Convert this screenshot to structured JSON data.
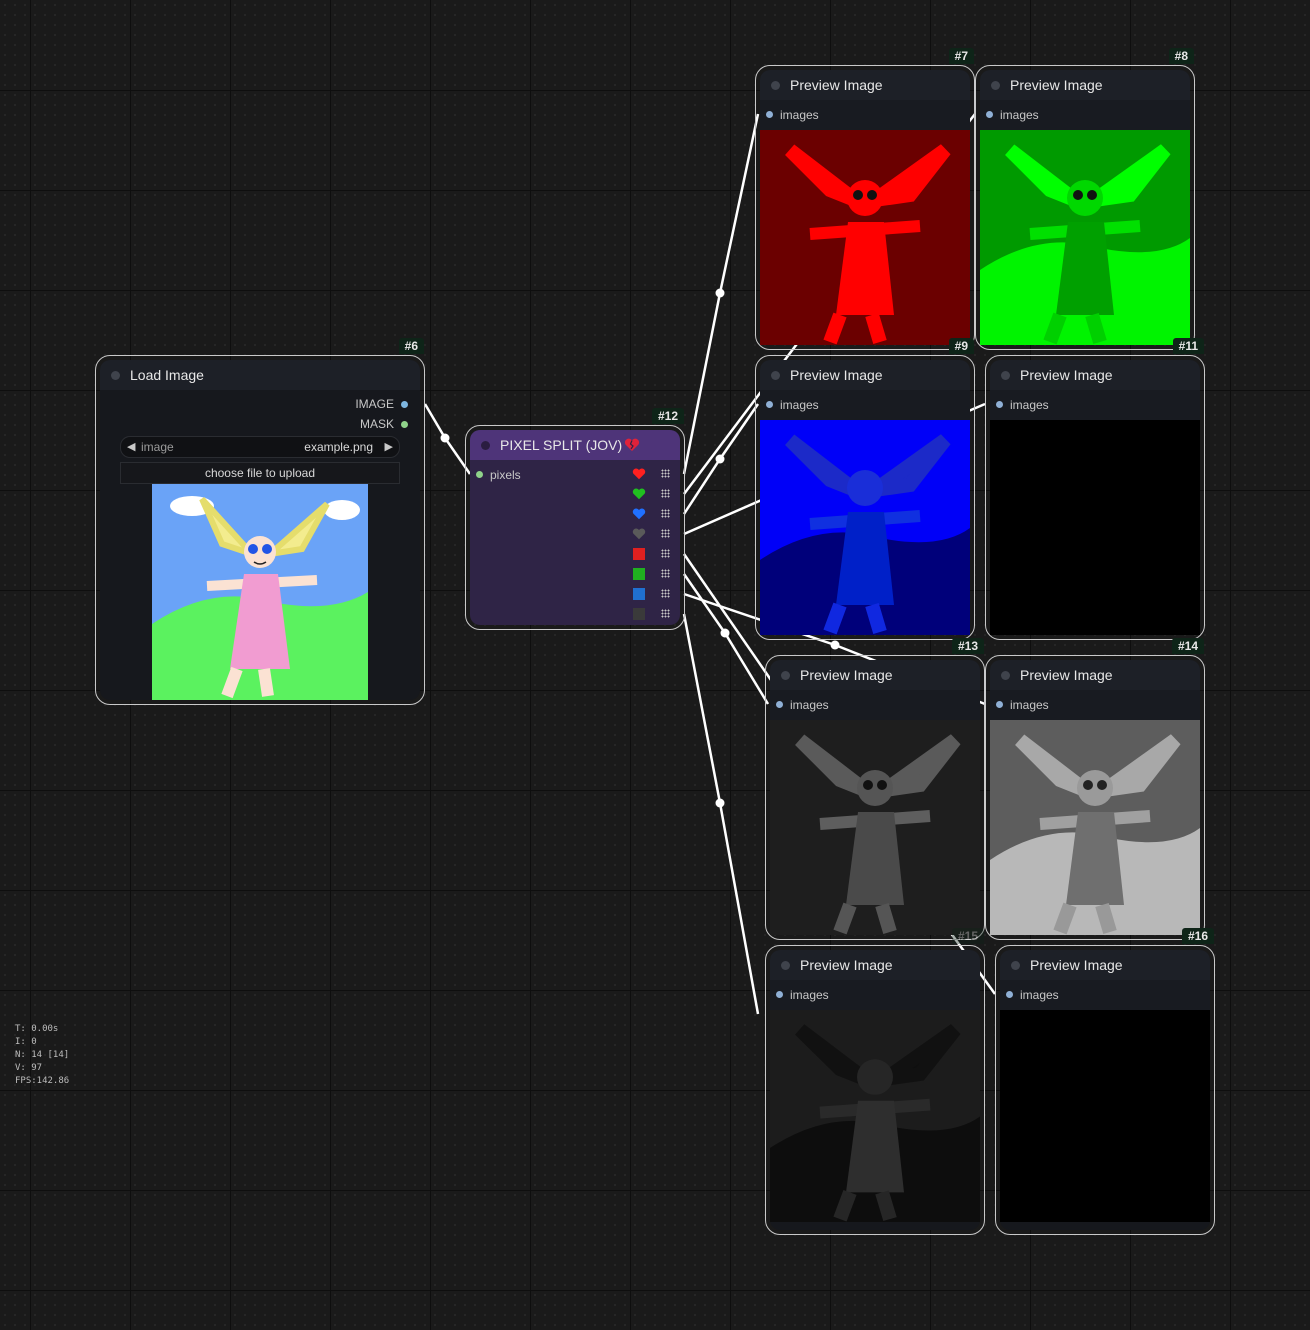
{
  "load_image": {
    "id": "#6",
    "title": "Load Image",
    "outputs": [
      {
        "label": "IMAGE",
        "color": "#7eb6e0"
      },
      {
        "label": "MASK",
        "color": "#8fd28a"
      }
    ],
    "widget_label": "image",
    "widget_value": "example.png",
    "upload_label": "choose file to upload"
  },
  "pixel_split": {
    "id": "#12",
    "title": "PIXEL SPLIT (JOV)",
    "title_icon": "broken-heart-icon",
    "input_label": "pixels",
    "outputs": [
      {
        "icon": "red-heart-icon",
        "color": "#ff2020"
      },
      {
        "icon": "green-heart-icon",
        "color": "#20c020"
      },
      {
        "icon": "blue-heart-icon",
        "color": "#2070ff"
      },
      {
        "icon": "grey-heart-icon",
        "color": "#5a5a5a"
      },
      {
        "icon": "red-square-icon",
        "color": "#e02020"
      },
      {
        "icon": "green-square-icon",
        "color": "#20b020"
      },
      {
        "icon": "blue-square-icon",
        "color": "#2070d0"
      },
      {
        "icon": "grey-square-icon",
        "color": "#3a3a3a"
      }
    ]
  },
  "preview_nodes": [
    {
      "id": "#7",
      "title": "Preview Image",
      "input": "images",
      "channel": "red"
    },
    {
      "id": "#8",
      "title": "Preview Image",
      "input": "images",
      "channel": "green"
    },
    {
      "id": "#9",
      "title": "Preview Image",
      "input": "images",
      "channel": "blue"
    },
    {
      "id": "#11",
      "title": "Preview Image",
      "input": "images",
      "channel": "empty"
    },
    {
      "id": "#13",
      "title": "Preview Image",
      "input": "images",
      "channel": "gray-dark"
    },
    {
      "id": "#14",
      "title": "Preview Image",
      "input": "images",
      "channel": "gray-light"
    },
    {
      "id": "#15",
      "title": "Preview Image",
      "input": "images",
      "channel": "gray-darker"
    },
    {
      "id": "#16",
      "title": "Preview Image",
      "input": "images",
      "channel": "empty"
    }
  ],
  "stats": {
    "t": "T: 0.00s",
    "i": "I: 0",
    "n": "N: 14 [14]",
    "v": "V: 97",
    "fps": "FPS:142.86"
  },
  "colors": {
    "canvas": "#1a1a1a",
    "node_bg": "#16181d",
    "title_bg": "#1d2027",
    "split_title": "#4e3479",
    "split_body": "#2f2446",
    "wire": "#ffffff"
  }
}
